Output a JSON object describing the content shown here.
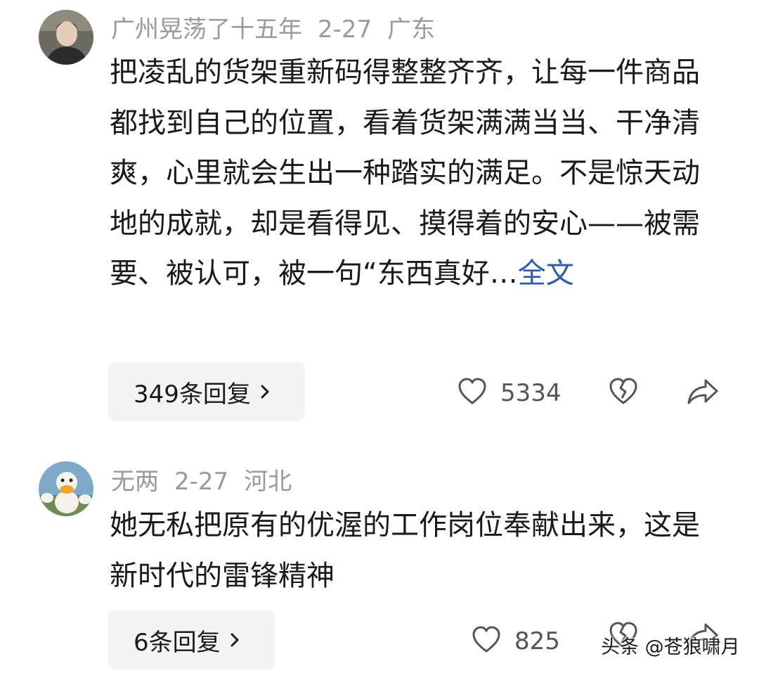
{
  "comments": [
    {
      "username": "广州晃荡了十五年",
      "date": "2-27",
      "location": "广东",
      "text": "把凌乱的货架重新码得整整齐齐，让每一件商品都找到自己的位置，看着货架满满当当、干净清爽，心里就会生出一种踏实的满足。不是惊天动地的成就，却是看得见、摸得着的安心——被需要、被认可，被一句“东西真好…",
      "expand_label": "全文",
      "replies_label": "349条回复",
      "like_count": "5334",
      "icons": [
        "avatar-person",
        "chevron-right-icon",
        "heart-icon",
        "broken-heart-icon",
        "share-icon"
      ]
    },
    {
      "username": "无两",
      "date": "2-27",
      "location": "河北",
      "text": "她无私把原有的优渥的工作岗位奉献出来，这是新时代的雷锋精神",
      "replies_label": "6条回复",
      "like_count": "825",
      "icons": [
        "avatar-duck",
        "chevron-right-icon",
        "heart-icon",
        "broken-heart-icon",
        "share-icon"
      ]
    }
  ],
  "watermark": "头条 @苍狼啸月",
  "colors": {
    "meta": "#9a9a9a",
    "link": "#2a5db0",
    "reply_bg": "#f4f4f4",
    "icon": "#555555"
  }
}
